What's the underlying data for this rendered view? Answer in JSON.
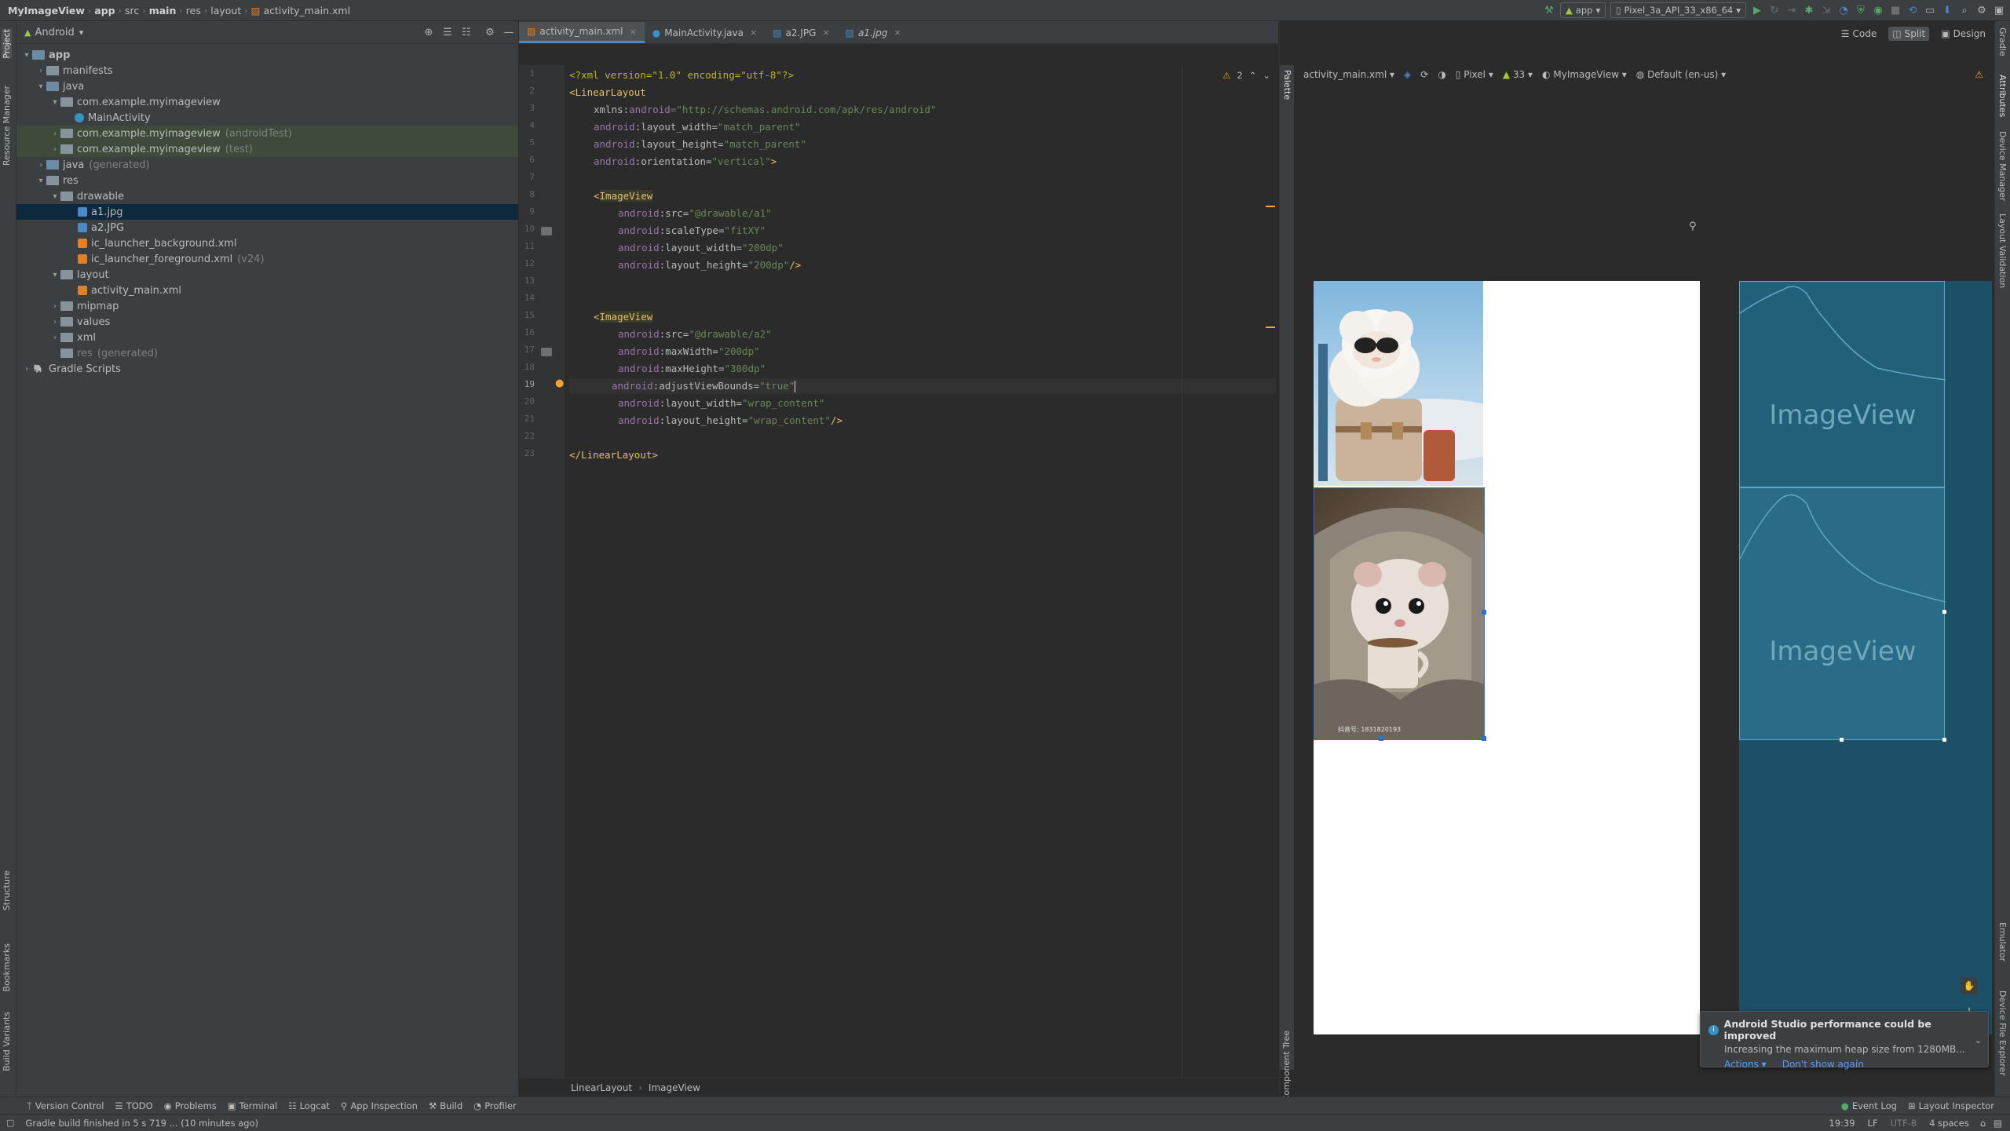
{
  "breadcrumb": [
    "MyImageView",
    "app",
    "src",
    "main",
    "res",
    "layout",
    "activity_main.xml"
  ],
  "run_config": "app",
  "device": "Pixel_3a_API_33_x86_64",
  "project_panel": {
    "view_mode": "Android",
    "tree": [
      {
        "label": "app",
        "bold": true
      },
      {
        "label": "manifests"
      },
      {
        "label": "java"
      },
      {
        "label": "com.example.myimageview"
      },
      {
        "label": "MainActivity"
      },
      {
        "label": "com.example.myimageview",
        "suffix": "(androidTest)"
      },
      {
        "label": "com.example.myimageview",
        "suffix": "(test)"
      },
      {
        "label": "java",
        "suffix": "(generated)"
      },
      {
        "label": "res"
      },
      {
        "label": "drawable"
      },
      {
        "label": "a1.jpg"
      },
      {
        "label": "a2.JPG"
      },
      {
        "label": "ic_launcher_background.xml"
      },
      {
        "label": "ic_launcher_foreground.xml",
        "suffix": "(v24)"
      },
      {
        "label": "layout"
      },
      {
        "label": "activity_main.xml"
      },
      {
        "label": "mipmap"
      },
      {
        "label": "values"
      },
      {
        "label": "xml"
      },
      {
        "label": "res",
        "suffix": "(generated)"
      },
      {
        "label": "Gradle Scripts"
      }
    ]
  },
  "editor_tabs": [
    "activity_main.xml",
    "MainActivity.java",
    "a2.JPG",
    "a1.jpg"
  ],
  "warnings_count": "2",
  "line_numbers": [
    "1",
    "2",
    "3",
    "4",
    "5",
    "6",
    "7",
    "8",
    "9",
    "10",
    "11",
    "12",
    "13",
    "14",
    "15",
    "16",
    "17",
    "18",
    "19",
    "20",
    "21",
    "22",
    "23"
  ],
  "code": {
    "l1": "<?xml version=\"1.0\" encoding=\"utf-8\"?>",
    "l2_tag": "<LinearLayout",
    "l3_attr": "xmlns:",
    "l3_ns": "android",
    "l3_val": "=\"http://schemas.android.com/apk/res/android\"",
    "l4": [
      "android",
      ":layout_width=",
      "\"match_parent\""
    ],
    "l5": [
      "android",
      ":layout_height=",
      "\"match_parent\""
    ],
    "l6": [
      "android",
      ":orientation=",
      "\"vertical\"",
      ">"
    ],
    "l8_tag": "ImageView",
    "l9": [
      "android",
      ":src=",
      "\"@drawable/a1\""
    ],
    "l10": [
      "android",
      ":scaleType=",
      "\"fitXY\""
    ],
    "l11": [
      "android",
      ":layout_width=",
      "\"200dp\""
    ],
    "l12": [
      "android",
      ":layout_height=",
      "\"200dp\"",
      "/>"
    ],
    "l15_tag": "ImageView",
    "l16": [
      "android",
      ":src=",
      "\"@drawable/a2\""
    ],
    "l17": [
      "android",
      ":maxWidth=",
      "\"200dp\""
    ],
    "l18": [
      "android",
      ":maxHeight=",
      "\"300dp\""
    ],
    "l19": [
      "android",
      ":adjustViewBounds=",
      "\"true\""
    ],
    "l20": [
      "android",
      ":layout_width=",
      "\"wrap_content\""
    ],
    "l21": [
      "android",
      ":layout_height=",
      "\"wrap_content\"",
      "/>"
    ],
    "l23": "</LinearLayout>"
  },
  "editor_breadcrumb": [
    "LinearLayout",
    "ImageView"
  ],
  "design": {
    "modes": [
      "Code",
      "Split",
      "Design"
    ],
    "file": "activity_main.xml",
    "device": "Pixel",
    "api": "33",
    "theme": "MyImageView",
    "locale": "Default (en-us)",
    "blueprint_label": "ImageView",
    "image_caption": "抖音号: 1831820193",
    "palette_label": "Palette",
    "component_tree_label": "Component Tree"
  },
  "notification": {
    "title": "Android Studio performance could be improved",
    "body": "Increasing the maximum heap size from 1280MB...",
    "action1": "Actions",
    "action2": "Don't show again"
  },
  "bottom_tools": [
    "Version Control",
    "TODO",
    "Problems",
    "Terminal",
    "Logcat",
    "App Inspection",
    "Build",
    "Profiler"
  ],
  "bottom_right_tools": [
    "Event Log",
    "Layout Inspector"
  ],
  "status": {
    "message": "Gradle build finished in 5 s 719 ... (10 minutes ago)",
    "position": "19:39",
    "line_sep": "LF",
    "encoding": "UTF-8",
    "indent": "4 spaces"
  },
  "left_strip": [
    "Project",
    "Resource Manager",
    "Structure",
    "Bookmarks",
    "Build Variants"
  ],
  "right_strip": [
    "Gradle",
    "Attributes",
    "Device Manager",
    "Layout Validation",
    "Emulator",
    "Device File Explorer"
  ]
}
